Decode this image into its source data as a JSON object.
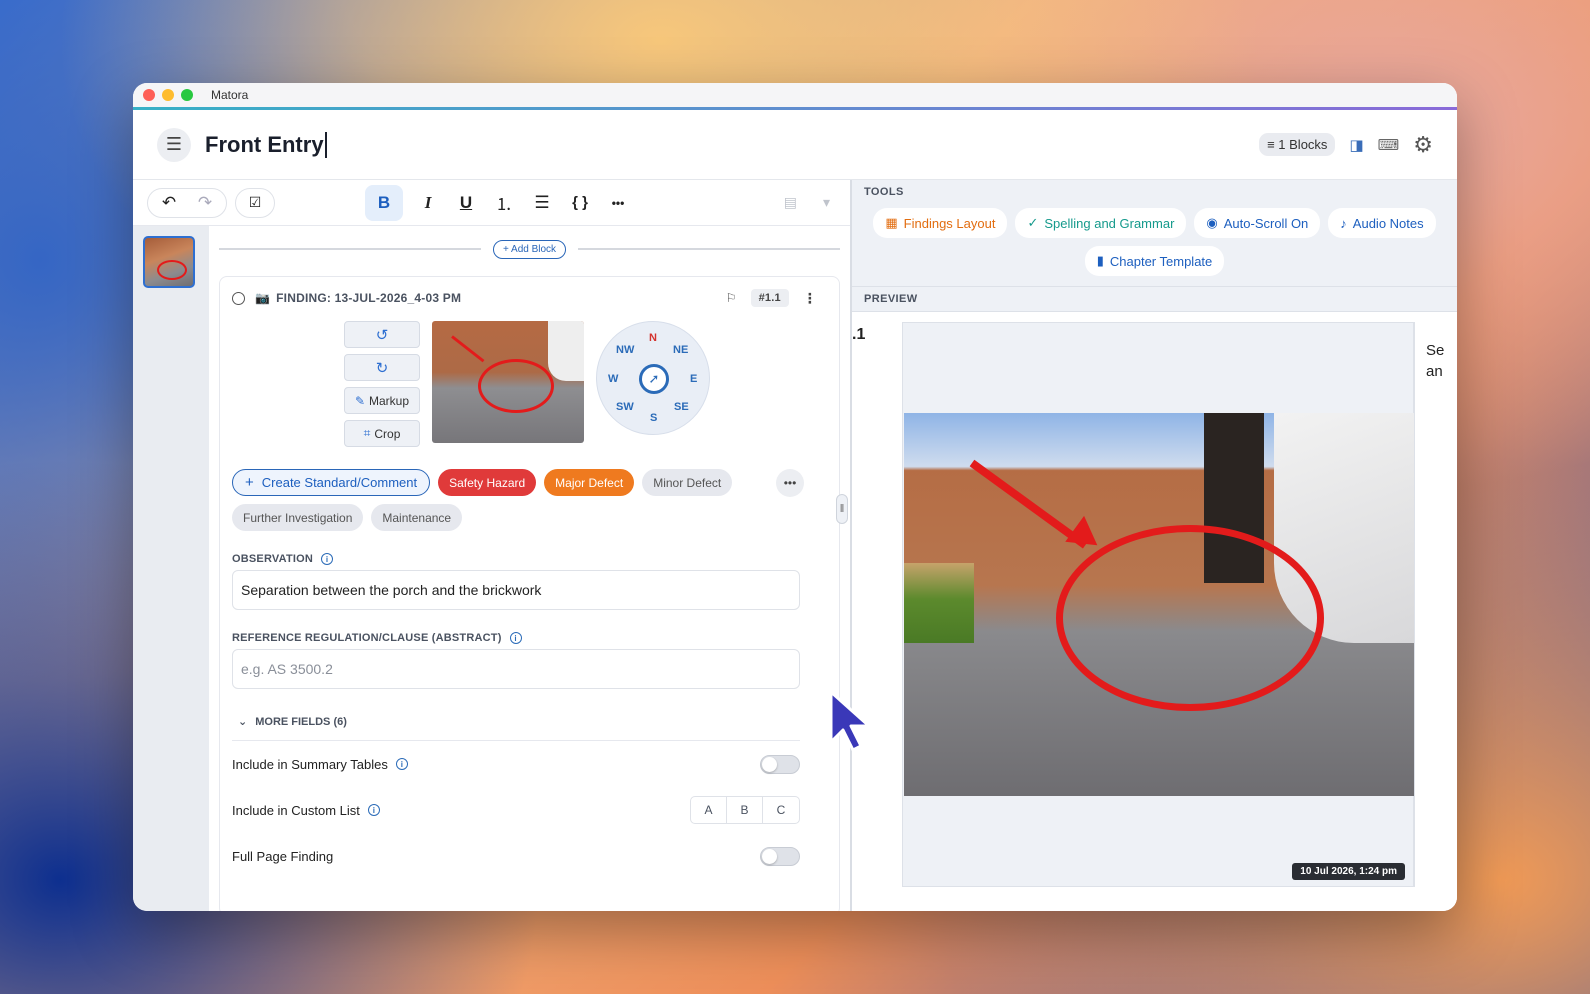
{
  "window": {
    "app_title": "Matora"
  },
  "header": {
    "title": "Front Entry",
    "blocks_label": "≡ 1 Blocks"
  },
  "toolbar": {
    "bold": "B",
    "italic": "I",
    "underline": "U",
    "code": "{ }",
    "more": "•••"
  },
  "editor": {
    "add_block_label": "+ Add Block",
    "finding": {
      "title": "FINDING: 13-JUL-2026_4-03 PM",
      "id_badge": "#1.1",
      "buttons": {
        "markup": "Markup",
        "crop": "Crop"
      },
      "compass": {
        "n": "N",
        "ne": "NE",
        "e": "E",
        "se": "SE",
        "s": "S",
        "sw": "SW",
        "w": "W",
        "nw": "NW"
      },
      "tags": {
        "create": "Create Standard/Comment",
        "hazard": "Safety Hazard",
        "major": "Major Defect",
        "minor": "Minor Defect",
        "further": "Further Investigation",
        "maintenance": "Maintenance",
        "more": "•••"
      },
      "observation_label": "OBSERVATION",
      "observation_value": "Separation between the porch and the brickwork",
      "reference_label": "REFERENCE REGULATION/CLAUSE (ABSTRACT)",
      "reference_placeholder": "e.g. AS 3500.2",
      "more_fields": "MORE FIELDS (6)",
      "summary_tables": "Include in Summary Tables",
      "custom_list": "Include in Custom List",
      "custom_options": [
        "A",
        "B",
        "C"
      ],
      "full_page": "Full Page Finding"
    }
  },
  "tools": {
    "label": "TOOLS",
    "items": [
      "Findings Layout",
      "Spelling and Grammar",
      "Auto-Scroll On",
      "Audio Notes",
      "Chapter Template"
    ]
  },
  "preview": {
    "label": "PREVIEW",
    "number": ".1",
    "timestamp": "10 Jul 2026, 1:24 pm",
    "text_fragment_1": "Se",
    "text_fragment_2": "an"
  },
  "colors": {
    "accent": "#1d5fbf",
    "hazard": "#e03a3a",
    "major": "#ef7a1f",
    "markup_red": "#e31b1b"
  }
}
